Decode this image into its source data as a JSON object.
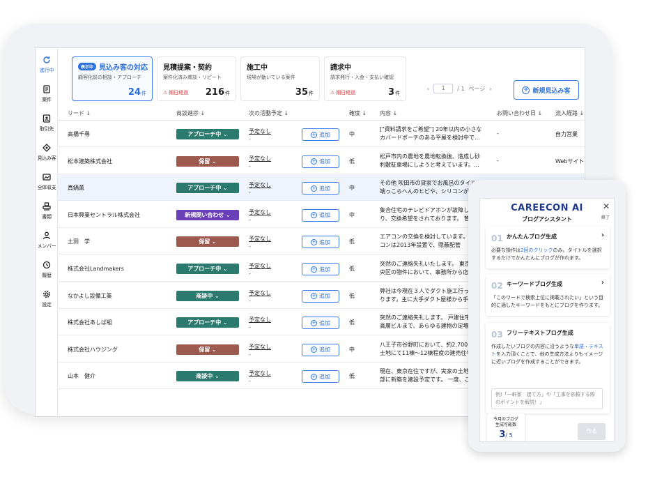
{
  "sidebar": {
    "items": [
      {
        "label": "進行中",
        "icon": "refresh-icon",
        "active": true
      },
      {
        "label": "案件",
        "icon": "document-icon"
      },
      {
        "label": "取引先",
        "icon": "contact-icon"
      },
      {
        "label": "見込み客",
        "icon": "target-icon"
      },
      {
        "label": "全体収支",
        "icon": "chart-icon"
      },
      {
        "label": "書類",
        "icon": "stamp-icon"
      },
      {
        "label": "メンバー",
        "icon": "person-icon"
      },
      {
        "label": "履歴",
        "icon": "history-icon"
      },
      {
        "label": "設定",
        "icon": "gear-icon"
      }
    ]
  },
  "cards": [
    {
      "badge": "表示中",
      "title": "見込み客の対応",
      "sub": "顧客化前の相談・アプローチ",
      "alert": "",
      "count": "24",
      "unit": "件"
    },
    {
      "badge": "",
      "title": "見積提案・契約",
      "sub": "案件化済み商談・リピート",
      "alert": "期日経過",
      "count": "216",
      "unit": "件"
    },
    {
      "badge": "",
      "title": "施工中",
      "sub": "現場が動いている案件",
      "alert": "",
      "count": "35",
      "unit": "件"
    },
    {
      "badge": "",
      "title": "請求中",
      "sub": "請求発行・入金・支払い確認",
      "alert": "期日経過",
      "count": "3",
      "unit": "件"
    }
  ],
  "pager": {
    "prev": "‹",
    "page": "1",
    "total": "/ 1",
    "label": "ページ",
    "next": "›"
  },
  "new_button": "新規見込み客",
  "table": {
    "headers": [
      "リード ↓",
      "商談進捗 ↓",
      "次の活動予定 ↓",
      "確度 ↓",
      "内容 ↓",
      "お問い合わせ日 ↓",
      "流入経路 ↓"
    ],
    "add_label": "追加",
    "rows": [
      {
        "lead": "高橋千尋",
        "status": "アプローチ中 ⌄",
        "color": "#2a7a6e",
        "act": "予定なし",
        "act2": "-",
        "conf": "中",
        "content": "[\"資料請求をご希望\"] 20年以内の小さなカバードポーチのある平屋を検討中で…",
        "inq": "-",
        "route": "自力営業",
        "hl": false
      },
      {
        "lead": "松本建築株式会社",
        "status": "保留 ⌄",
        "color": "#9c5a4e",
        "act": "予定なし",
        "act2": "-",
        "conf": "低",
        "content": "松戸市内の農地を農地転換後、造成し砂利敷駐車場にしようと考えています。…",
        "inq": "-",
        "route": "Webサイト",
        "hl": false
      },
      {
        "lead": "真鍋薫",
        "status": "アプローチ中 ⌄",
        "color": "#2a7a6e",
        "act": "予定なし",
        "act2": "-",
        "conf": "中",
        "content": "その他 吹田市の貸家でお風呂のタイルが端っこらへんのヒビや、シリコンが劣",
        "inq": "",
        "route": "",
        "hl": true
      },
      {
        "lead": "日本興業セントラル株式会社",
        "status": "新規問い合わせ ⌄",
        "color": "#6a3fb8",
        "act": "予定なし",
        "act2": "-",
        "conf": "中",
        "content": "集合住宅のテレビドアホンが故障しており、交換希望をされております。 管",
        "inq": "",
        "route": "",
        "hl": false
      },
      {
        "lead": "土田　学",
        "status": "保留 ⌄",
        "color": "#9c5a4e",
        "act": "予定なし",
        "act2": "-",
        "conf": "低",
        "content": "エアコンの交換を検討しています。エアコンは2013年設置で、隠蔽配管",
        "inq": "",
        "route": "",
        "hl": false
      },
      {
        "lead": "株式会社Landmakers",
        "status": "アプローチ中 ⌄",
        "color": "#2a7a6e",
        "act": "予定なし",
        "act2": "-",
        "conf": "低",
        "content": "突然のご連絡失礼いたします。 東京都中央区の物件において、事務所から店舗",
        "inq": "",
        "route": "",
        "hl": false
      },
      {
        "lead": "なかよし設備工業",
        "status": "商談中 ⌄",
        "color": "#2a7a6e",
        "act": "予定なし",
        "act2": "-",
        "conf": "低",
        "content": "弊社は今現在３人でダクト施工行っております。主に大手ダクト屋様から手間請",
        "inq": "",
        "route": "",
        "hl": false
      },
      {
        "lead": "株式会社あしば組",
        "status": "アプローチ中 ⌄",
        "color": "#2a7a6e",
        "act": "予定なし",
        "act2": "-",
        "conf": "低",
        "content": "突然のご連絡失礼します。 戸建住宅、中高層ビルまで、あらゆる建物の足場",
        "inq": "",
        "route": "",
        "hl": false
      },
      {
        "lead": "株式会社ハウジング",
        "status": "保留 ⌄",
        "color": "#9c5a4e",
        "act": "予定なし",
        "act2": "-",
        "conf": "中",
        "content": "八王子市谷野町において、約2,700㎡の土地にて11棟〜12棟程度の建売住宅の",
        "inq": "",
        "route": "",
        "hl": false
      },
      {
        "lead": "山本　健介",
        "status": "商談中 ⌄",
        "color": "#2a7a6e",
        "act": "予定なし",
        "act2": "-",
        "conf": "低",
        "content": "現在、東京在住ですが、実家の土地の一部に新築を建設予定です。 一度、ご",
        "inq": "",
        "route": "",
        "hl": false
      }
    ]
  },
  "assistant": {
    "brand": "CAREECON AI",
    "subtitle": "ブログアシスタント",
    "close_label": "終了",
    "options": [
      {
        "num": "01",
        "title": "かんたんブログ生成",
        "desc_a": "必要な操作は",
        "desc_hl": "2回のクリック",
        "desc_b": "のみ。タイトルを選択するだけでかんたんにブログが作れます。"
      },
      {
        "num": "02",
        "title": "キーワードブログ生成",
        "desc_a": "「このワードで検索上位に掲載されたい」という目的に適したキーワードをもとにブログを作ります。",
        "desc_hl": "",
        "desc_b": ""
      },
      {
        "num": "03",
        "title": "フリーテキストブログ生成",
        "desc_a": "作成したいブログの内容に沿うような",
        "desc_hl": "単語・テキスト",
        "desc_b": "を入力頂くことで、他の生成方法よりもイメージに近いブログを作成することができます。"
      }
    ],
    "placeholder": "例)「一軒家　建て方」や「工事を依頼する際のポイントを解説！」",
    "quota_label1": "今月のブログ",
    "quota_label2": "生成可能数",
    "quota_used": "3",
    "quota_total": "/ 5",
    "make_button": "作る"
  },
  "colors": {
    "accent": "#2a6fdb",
    "approach": "#2a7a6e",
    "hold": "#9c5a4e",
    "new": "#6a3fb8",
    "alert": "#d23b3b"
  }
}
